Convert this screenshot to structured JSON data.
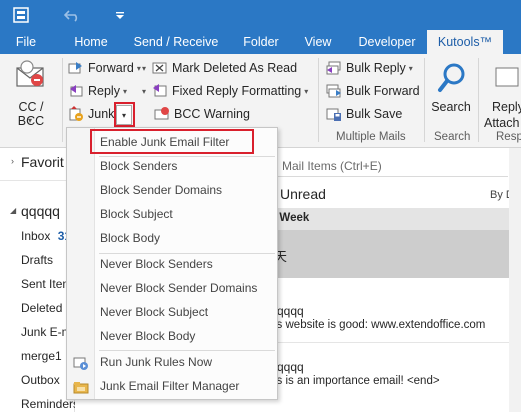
{
  "titlebar": {
    "icons": [
      "app-icon",
      "undo-icon",
      "redo-icon"
    ]
  },
  "tabs": [
    {
      "label": "File"
    },
    {
      "label": "Home"
    },
    {
      "label": "Send / Receive"
    },
    {
      "label": "Folder"
    },
    {
      "label": "View"
    },
    {
      "label": "Developer"
    },
    {
      "label": "Kutools™",
      "active": true
    }
  ],
  "ribbon": {
    "cc_bcc": "CC / BCC",
    "forward": "Forward",
    "reply": "Reply",
    "junk": "Junk",
    "mark_deleted": "Mark Deleted As Read",
    "fixed_reply": "Fixed Reply Formatting",
    "bcc_warning": "BCC Warning",
    "bulk_reply": "Bulk Reply",
    "bulk_forward": "Bulk Forward",
    "bulk_save": "Bulk Save",
    "multiple_mails": "Multiple Mails",
    "search": "Search",
    "search_group": "Search",
    "reply_attach": "Reply",
    "reply_attach2": "Attach",
    "resp": "Resp"
  },
  "leftnav": {
    "favorites": "Favorit",
    "account": "qqqqq",
    "inbox": "Inbox",
    "inbox_count": "31",
    "drafts": "Drafts",
    "sent": "Sent Item",
    "deleted": "Deleted I",
    "junk": "Junk E-m",
    "merge": "merge1",
    "outbox": "Outbox",
    "reminders": "Reminders"
  },
  "main": {
    "search_placeholder": "h All Mail Items (Ctrl+E)",
    "unread": "Unread",
    "by_date": "By Da",
    "last_week": "st Week",
    "chinese": "天",
    "mail1_sender": "qqqq",
    "mail1_preview": "is website is good: www.extendoffice.com",
    "mail2_sender": "qqqq",
    "mail2_preview": "is is an importance email! <end>"
  },
  "menu": {
    "items": [
      "Enable Junk Email Filter",
      "Block Senders",
      "Block Sender Domains",
      "Block Subject",
      "Block Body",
      "Never Block Senders",
      "Never Block Sender Domains",
      "Never Block Subject",
      "Never Block Body",
      "Run Junk Rules Now",
      "Junk Email Filter Manager"
    ]
  },
  "colors": {
    "accent": "#2b78c5",
    "highlight_border": "#d9202d"
  }
}
